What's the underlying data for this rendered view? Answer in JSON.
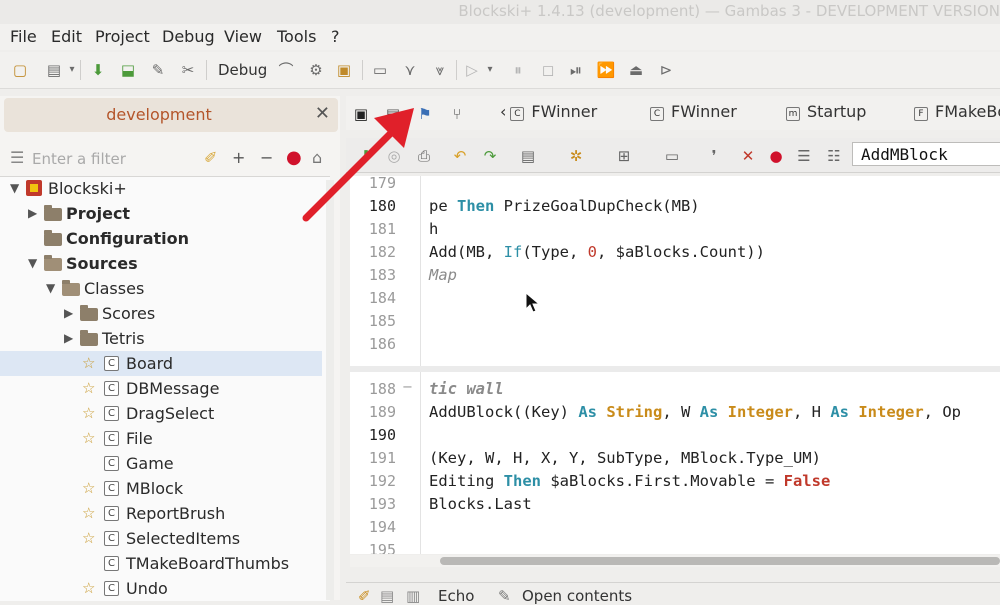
{
  "window": {
    "title": "Blockski+ 1.4.13 (development) — Gambas 3 - DEVELOPMENT VERSION"
  },
  "menu": [
    "File",
    "Edit",
    "Project",
    "Debug",
    "View",
    "Tools",
    "?"
  ],
  "toolbar": {
    "debug_label": "Debug"
  },
  "project_panel": {
    "header": "development",
    "filter_placeholder": "Enter a filter",
    "tree": [
      {
        "label": "Blockski+",
        "level": 0,
        "expanded": true,
        "kind": "app",
        "bold": false
      },
      {
        "label": "Project",
        "level": 1,
        "expanded": false,
        "kind": "folder",
        "bold": true
      },
      {
        "label": "Configuration",
        "level": 1,
        "kind": "folder",
        "bold": true
      },
      {
        "label": "Sources",
        "level": 1,
        "expanded": true,
        "kind": "folder",
        "bold": true
      },
      {
        "label": "Classes",
        "level": 2,
        "expanded": true,
        "kind": "folder"
      },
      {
        "label": "Scores",
        "level": 3,
        "expanded": false,
        "kind": "folder"
      },
      {
        "label": "Tetris",
        "level": 3,
        "expanded": false,
        "kind": "folder"
      },
      {
        "label": "Board",
        "level": 3,
        "kind": "class",
        "starred": true,
        "selected": true
      },
      {
        "label": "DBMessage",
        "level": 3,
        "kind": "class",
        "starred": true
      },
      {
        "label": "DragSelect",
        "level": 3,
        "kind": "class",
        "starred": true
      },
      {
        "label": "File",
        "level": 3,
        "kind": "class",
        "starred": true
      },
      {
        "label": "Game",
        "level": 3,
        "kind": "class",
        "starred": false
      },
      {
        "label": "MBlock",
        "level": 3,
        "kind": "class",
        "starred": true
      },
      {
        "label": "ReportBrush",
        "level": 3,
        "kind": "class",
        "starred": true
      },
      {
        "label": "SelectedItems",
        "level": 3,
        "kind": "class",
        "starred": true
      },
      {
        "label": "TMakeBoardThumbs",
        "level": 3,
        "kind": "class",
        "starred": false
      },
      {
        "label": "Undo",
        "level": 3,
        "kind": "class",
        "starred": true
      }
    ]
  },
  "tabs": [
    {
      "label": "FWinner",
      "icon": "C"
    },
    {
      "label": "FWinner",
      "icon": "C"
    },
    {
      "label": "Startup",
      "icon": "m"
    },
    {
      "label": "FMakeBo",
      "icon": "F"
    }
  ],
  "editor": {
    "procedure": "AddMBlock",
    "lines_top": [
      "179",
      "180",
      "181",
      "182",
      "183",
      "184",
      "185",
      "186"
    ],
    "lines_bottom": [
      "188",
      "189",
      "190",
      "191",
      "192",
      "193",
      "194",
      "195"
    ],
    "current_line": "190",
    "code": {
      "l180_a": "pe ",
      "l180_kw": "Then",
      "l180_b": " PrizeGoalDupCheck(MB)",
      "l181": "h",
      "l182_a": "Add(MB, ",
      "l182_kw": "If",
      "l182_b": "(Type, ",
      "l182_num": "0",
      "l182_c": ", $aBlocks.Count))",
      "l183": "Map",
      "l188": "tic wall",
      "l189_a": "AddUBlock((Key) ",
      "l189_as1": "As",
      "l189_t1": "String",
      "l189_b": ", W ",
      "l189_as2": "As",
      "l189_t2": "Integer",
      "l189_c": ", H ",
      "l189_as3": "As",
      "l189_t3": "Integer",
      "l189_d": ", Op",
      "l191": "(Key, W, H, X, Y, SubType, MBlock.Type_UM)",
      "l192_a": "Editing ",
      "l192_kw": "Then",
      "l192_b": " $aBlocks.First.Movable = ",
      "l192_f": "False",
      "l193": "Blocks.Last"
    }
  },
  "bottom_bar": {
    "echo_label": "Echo",
    "open_contents_label": "Open contents"
  },
  "colors": {
    "annotation_arrow": "#e0202a",
    "selection": "#dde7f4",
    "header_text": "#b4552a"
  }
}
